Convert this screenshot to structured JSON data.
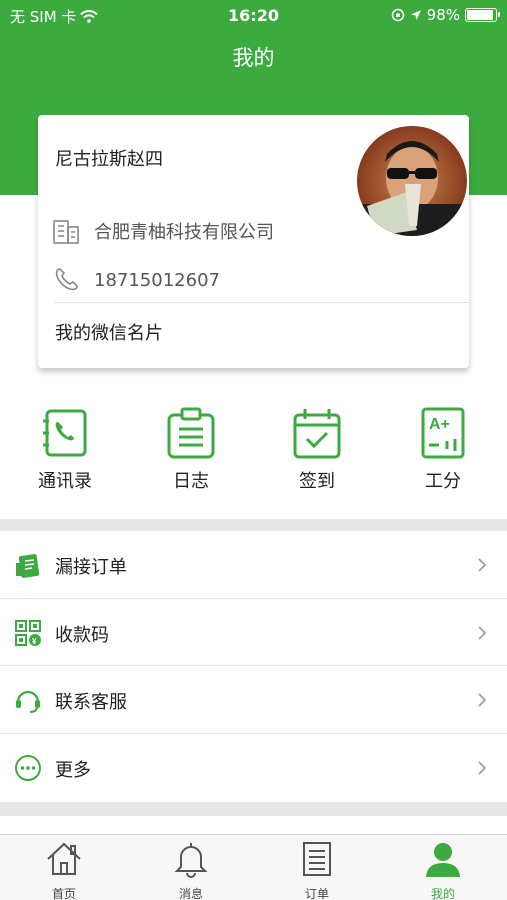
{
  "status_bar": {
    "carrier": "无 SIM 卡",
    "time": "16:20",
    "battery": "98%",
    "battery_level": 0.98
  },
  "header": {
    "title": "我的"
  },
  "profile": {
    "name": "尼古拉斯赵四",
    "company": "合肥青柚科技有限公司",
    "phone": "18715012607",
    "wechat_card": "我的微信名片"
  },
  "quick_actions": [
    {
      "label": "通讯录",
      "icon": "contacts-icon"
    },
    {
      "label": "日志",
      "icon": "log-icon"
    },
    {
      "label": "签到",
      "icon": "checkin-icon"
    },
    {
      "label": "工分",
      "icon": "score-icon"
    }
  ],
  "menu": [
    {
      "label": "漏接订单",
      "icon": "missed-order-icon"
    },
    {
      "label": "收款码",
      "icon": "qr-code-icon"
    },
    {
      "label": "联系客服",
      "icon": "headset-icon"
    },
    {
      "label": "更多",
      "icon": "more-icon"
    }
  ],
  "tabbar": [
    {
      "label": "首页",
      "icon": "home-icon"
    },
    {
      "label": "消息",
      "icon": "bell-icon"
    },
    {
      "label": "订单",
      "icon": "order-icon"
    },
    {
      "label": "我的",
      "icon": "user-icon",
      "active": true
    }
  ],
  "colors": {
    "accent": "#3daa40",
    "divider": "#e6e6e6"
  }
}
